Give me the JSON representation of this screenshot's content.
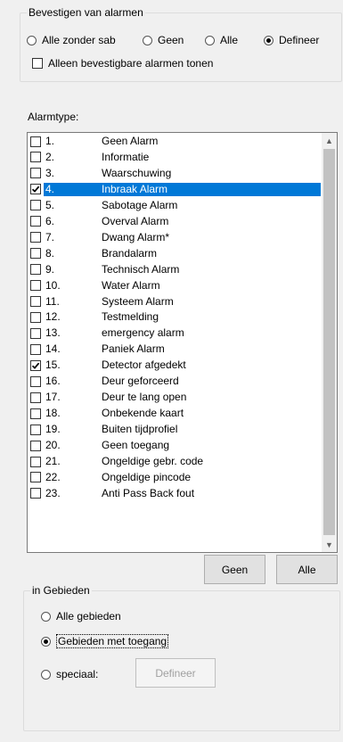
{
  "confirm_group": {
    "title": "Bevestigen van alarmen",
    "radios": [
      {
        "label": "Alle zonder sab",
        "checked": false
      },
      {
        "label": "Geen",
        "checked": false
      },
      {
        "label": "Alle",
        "checked": false
      },
      {
        "label": "Defineer",
        "checked": true
      }
    ],
    "only_confirmable": {
      "label": "Alleen bevestigbare alarmen tonen",
      "checked": false
    }
  },
  "alarmtype": {
    "label": "Alarmtype:",
    "items": [
      {
        "num": "1.",
        "name": "Geen Alarm",
        "checked": false,
        "selected": false
      },
      {
        "num": "2.",
        "name": "Informatie",
        "checked": false,
        "selected": false
      },
      {
        "num": "3.",
        "name": "Waarschuwing",
        "checked": false,
        "selected": false
      },
      {
        "num": "4.",
        "name": "Inbraak Alarm",
        "checked": true,
        "selected": true
      },
      {
        "num": "5.",
        "name": "Sabotage Alarm",
        "checked": false,
        "selected": false
      },
      {
        "num": "6.",
        "name": "Overval Alarm",
        "checked": false,
        "selected": false
      },
      {
        "num": "7.",
        "name": "Dwang Alarm*",
        "checked": false,
        "selected": false
      },
      {
        "num": "8.",
        "name": "Brandalarm",
        "checked": false,
        "selected": false
      },
      {
        "num": "9.",
        "name": "Technisch Alarm",
        "checked": false,
        "selected": false
      },
      {
        "num": "10.",
        "name": "Water Alarm",
        "checked": false,
        "selected": false
      },
      {
        "num": "11.",
        "name": "Systeem Alarm",
        "checked": false,
        "selected": false
      },
      {
        "num": "12.",
        "name": "Testmelding",
        "checked": false,
        "selected": false
      },
      {
        "num": "13.",
        "name": "emergency alarm",
        "checked": false,
        "selected": false
      },
      {
        "num": "14.",
        "name": "Paniek Alarm",
        "checked": false,
        "selected": false
      },
      {
        "num": "15.",
        "name": "Detector afgedekt",
        "checked": true,
        "selected": false
      },
      {
        "num": "16.",
        "name": "Deur geforceerd",
        "checked": false,
        "selected": false
      },
      {
        "num": "17.",
        "name": "Deur te lang open",
        "checked": false,
        "selected": false
      },
      {
        "num": "18.",
        "name": "Onbekende kaart",
        "checked": false,
        "selected": false
      },
      {
        "num": "19.",
        "name": "Buiten tijdprofiel",
        "checked": false,
        "selected": false
      },
      {
        "num": "20.",
        "name": "Geen toegang",
        "checked": false,
        "selected": false
      },
      {
        "num": "21.",
        "name": "Ongeldige gebr. code",
        "checked": false,
        "selected": false
      },
      {
        "num": "22.",
        "name": "Ongeldige pincode",
        "checked": false,
        "selected": false
      },
      {
        "num": "23.",
        "name": "Anti Pass Back fout",
        "checked": false,
        "selected": false
      }
    ],
    "buttons": {
      "none": "Geen",
      "all": "Alle"
    }
  },
  "areas_group": {
    "title": "in Gebieden",
    "radios": [
      {
        "label": "Alle gebieden",
        "checked": false
      },
      {
        "label": "Gebieden met toegang",
        "checked": true
      },
      {
        "label": "speciaal:",
        "checked": false
      }
    ],
    "define_button": "Defineer"
  }
}
